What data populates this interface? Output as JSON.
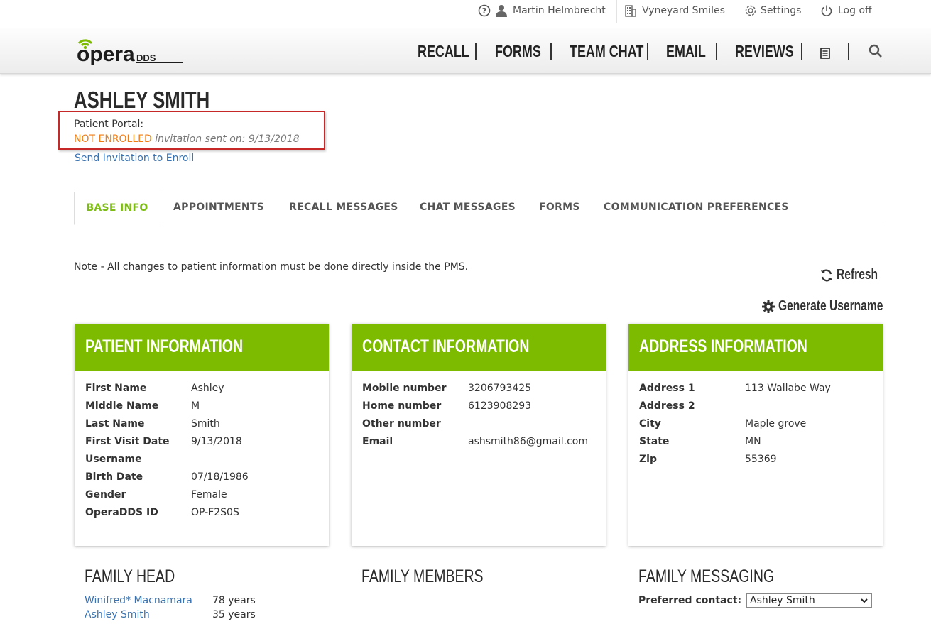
{
  "topbar": {
    "user": "Martin Helmbrecht",
    "practice": "Vyneyard Smiles",
    "settings": "Settings",
    "logoff": "Log off"
  },
  "brand": {
    "logo_main": "opera",
    "logo_sub": "DDS",
    "accent": "#7dbb00"
  },
  "nav": [
    "RECALL",
    "FORMS",
    "TEAM CHAT",
    "EMAIL",
    "REVIEWS"
  ],
  "patient": {
    "name": "ASHLEY SMITH",
    "portal_label": "Patient Portal:",
    "portal_status": "NOT ENROLLED",
    "portal_invite": "invitation sent on: 9/13/2018",
    "enroll_link": "Send Invitation to Enroll"
  },
  "tabs": [
    "BASE INFO",
    "APPOINTMENTS",
    "RECALL MESSAGES",
    "CHAT MESSAGES",
    "FORMS",
    "COMMUNICATION PREFERENCES"
  ],
  "note": "Note - All changes to patient information must be done directly inside the PMS.",
  "actions": {
    "refresh": "Refresh",
    "generate": "Generate Username"
  },
  "cards": {
    "patient": {
      "title": "PATIENT INFORMATION",
      "rows": [
        {
          "k": "First Name",
          "v": "Ashley"
        },
        {
          "k": "Middle Name",
          "v": "M"
        },
        {
          "k": "Last Name",
          "v": "Smith"
        },
        {
          "k": "First Visit Date",
          "v": "9/13/2018"
        },
        {
          "k": "Username",
          "v": ""
        },
        {
          "k": "Birth Date",
          "v": "07/18/1986"
        },
        {
          "k": "Gender",
          "v": "Female"
        },
        {
          "k": "OperaDDS ID",
          "v": "OP-F2S0S"
        }
      ]
    },
    "contact": {
      "title": "CONTACT INFORMATION",
      "rows": [
        {
          "k": "Mobile number",
          "v": "3206793425"
        },
        {
          "k": "Home number",
          "v": "6123908293"
        },
        {
          "k": "Other number",
          "v": ""
        },
        {
          "k": "Email",
          "v": "ashsmith86@gmail.com"
        }
      ]
    },
    "address": {
      "title": "ADDRESS INFORMATION",
      "rows": [
        {
          "k": "Address 1",
          "v": "113 Wallabe Way"
        },
        {
          "k": "Address 2",
          "v": ""
        },
        {
          "k": "City",
          "v": "Maple grove"
        },
        {
          "k": "State",
          "v": "MN"
        },
        {
          "k": "Zip",
          "v": "55369"
        }
      ]
    }
  },
  "family": {
    "head_title": "FAMILY HEAD",
    "members_title": "FAMILY MEMBERS",
    "messaging_title": "FAMILY MESSAGING",
    "head_list": [
      {
        "name": "Winifred* Macnamara",
        "age": "78 years"
      },
      {
        "name": "Ashley Smith",
        "age": "35 years"
      }
    ],
    "preferred_label": "Preferred contact:",
    "preferred_value": "Ashley Smith"
  }
}
